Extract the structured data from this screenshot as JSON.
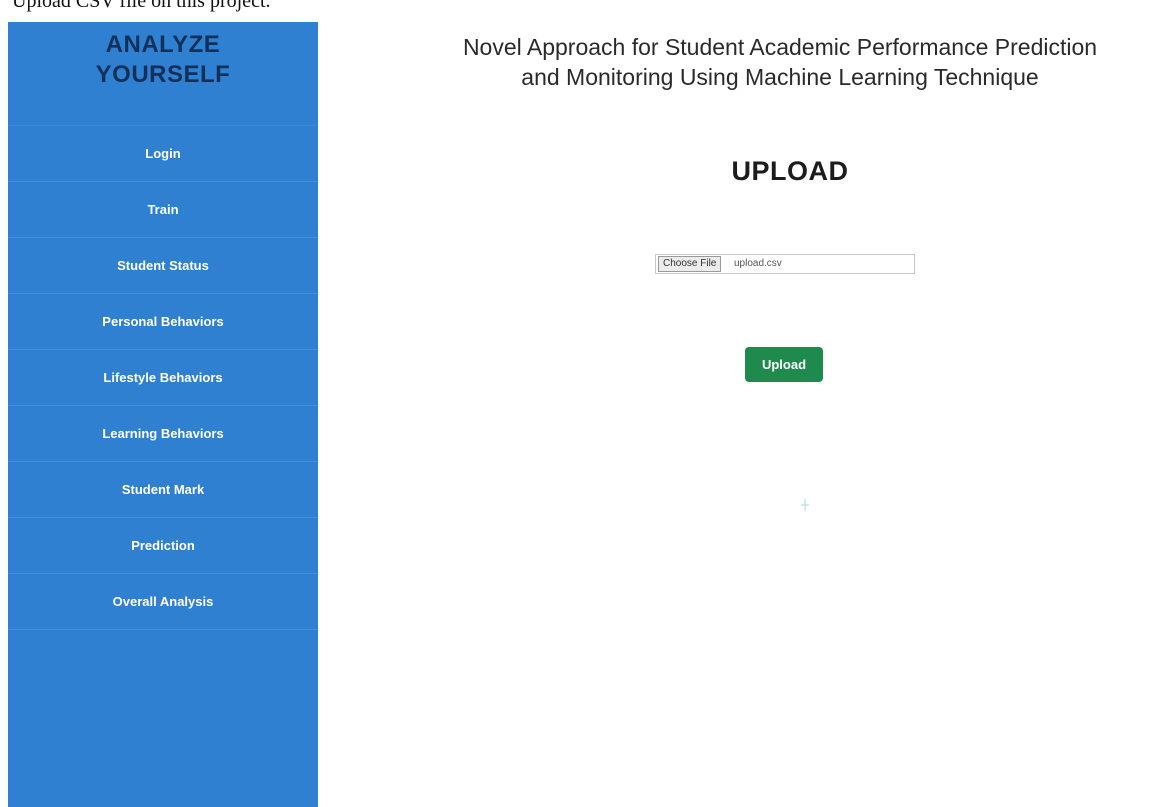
{
  "caption": "Upload CSV file on this project.",
  "sidebar": {
    "brand_line1": "ANALYZE",
    "brand_line2": "YOURSELF",
    "items": [
      {
        "label": "Login"
      },
      {
        "label": "Train"
      },
      {
        "label": "Student Status"
      },
      {
        "label": "Personal Behaviors"
      },
      {
        "label": "Lifestyle Behaviors"
      },
      {
        "label": "Learning Behaviors"
      },
      {
        "label": "Student Mark"
      },
      {
        "label": "Prediction"
      },
      {
        "label": "Overall Analysis"
      }
    ],
    "bg_color": "#2f80d0",
    "brand_color": "#12315a"
  },
  "header": {
    "title_line1": "Novel Approach for Student Academic Performance Prediction",
    "title_line2": "and Monitoring Using Machine Learning Technique"
  },
  "main": {
    "heading": "UPLOAD",
    "file_input": {
      "button_label": "Choose File",
      "file_name": "upload.csv"
    },
    "submit_label": "Upload",
    "submit_color": "#1f8a4e"
  }
}
